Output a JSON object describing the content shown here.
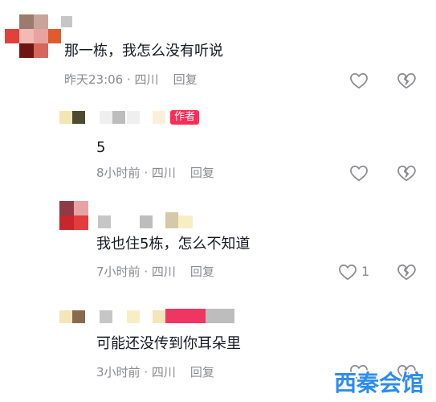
{
  "comments": [
    {
      "text": "那一栋，我怎么没有听说",
      "time": "昨天23:06",
      "location": "四川",
      "reply_label": "回复",
      "like_count": ""
    },
    {
      "badge": "作者",
      "text": "5",
      "time": "8小时前",
      "location": "四川",
      "reply_label": "回复",
      "like_count": ""
    },
    {
      "text": "我也住5栋，怎么不知道",
      "time": "7小时前",
      "location": "四川",
      "reply_label": "回复",
      "like_count": "1"
    },
    {
      "text": "可能还没传到你耳朵里",
      "time": "3小时前",
      "location": "四川",
      "reply_label": "回复",
      "like_count": ""
    }
  ],
  "separator": " · ",
  "watermark": "西秦会馆",
  "icons": {
    "like": "heart-outline-icon",
    "dislike": "broken-heart-icon"
  },
  "colors": {
    "text": "#161823",
    "meta": "#8a8b91",
    "badge": "#fe2c55",
    "watermark": "#2d8cf0"
  }
}
